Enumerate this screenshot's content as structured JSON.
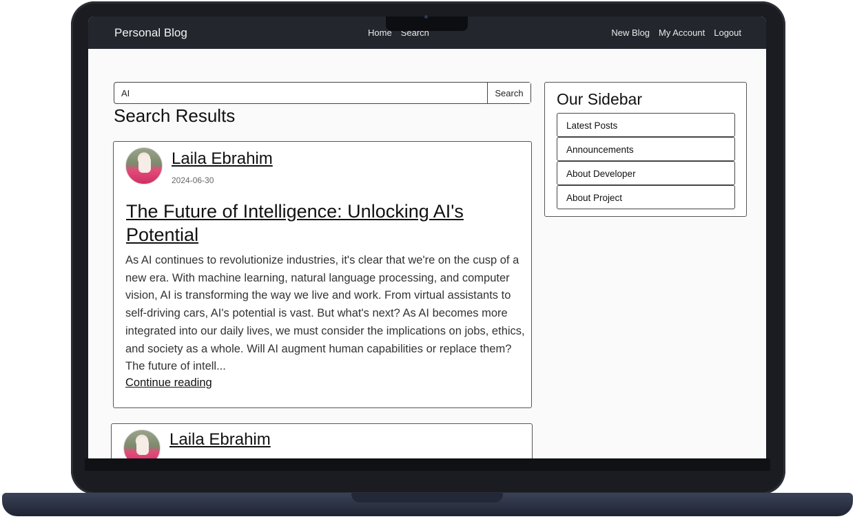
{
  "navbar": {
    "brand": "Personal Blog",
    "center_links": [
      "Home",
      "Search"
    ],
    "right_links": [
      "New Blog",
      "My Account",
      "Logout"
    ]
  },
  "search": {
    "value": "AI",
    "button_label": "Search"
  },
  "results": {
    "heading": "Search Results",
    "posts": [
      {
        "author": "Laila Ebrahim",
        "date": "2024-06-30",
        "title": "The Future of Intelligence: Unlocking AI's Potential",
        "excerpt": "As AI continues to revolutionize industries, it's clear that we're on the cusp of a new era. With machine learning, natural language processing, and computer vision, AI is transforming the way we live and work. From virtual assistants to self-driving cars, AI's potential is vast. But what's next? As AI becomes more integrated into our daily lives, we must consider the implications on jobs, ethics, and society as a whole. Will AI augment human capabilities or replace them? The future of intell...",
        "continue_label": "Continue reading"
      },
      {
        "author": "Laila Ebrahim"
      }
    ]
  },
  "sidebar": {
    "title": "Our Sidebar",
    "items": [
      "Latest Posts",
      "Announcements",
      "About Developer",
      "About Project"
    ]
  }
}
